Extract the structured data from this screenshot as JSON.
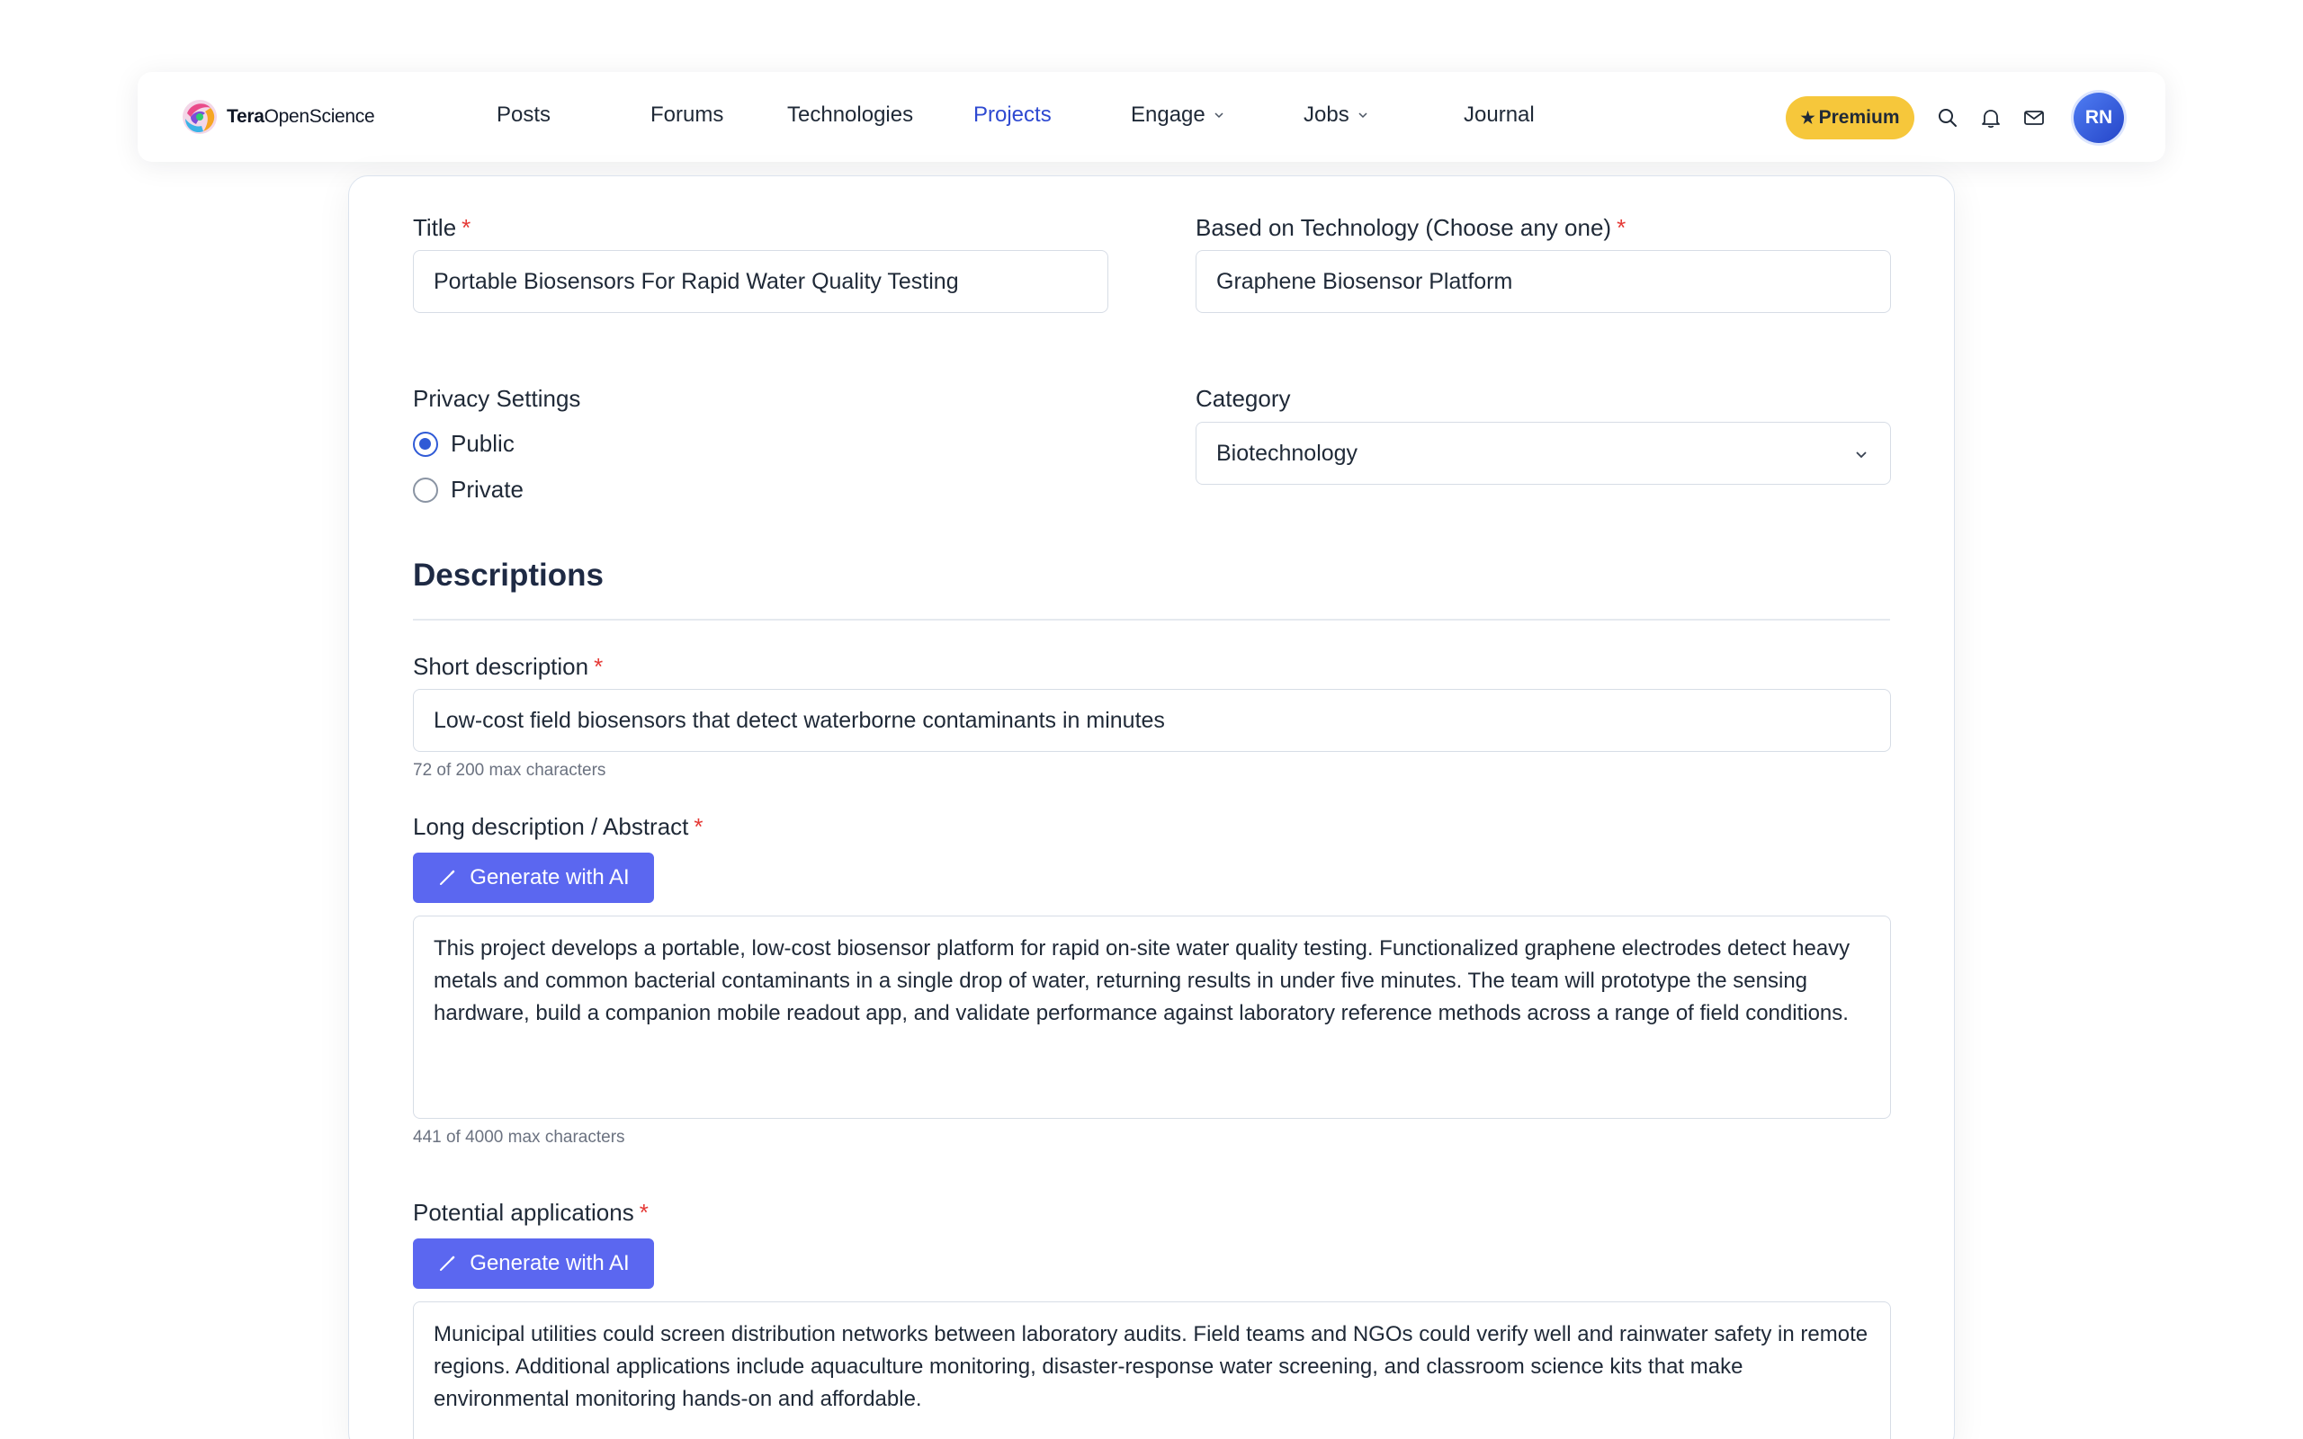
{
  "brand": {
    "name_bold": "Tera",
    "name_rest": "OpenScience"
  },
  "nav": {
    "items": [
      {
        "label": "Posts"
      },
      {
        "label": "Forums"
      },
      {
        "label": "Technologies"
      },
      {
        "label": "Projects",
        "active": true
      },
      {
        "label": "Engage",
        "dropdown": true
      },
      {
        "label": "Jobs",
        "dropdown": true
      },
      {
        "label": "Journal"
      }
    ],
    "premium_label": "Premium",
    "avatar_initials": "RN",
    "icons": [
      "search-icon",
      "bell-icon",
      "mail-icon"
    ]
  },
  "form": {
    "title": {
      "label": "Title",
      "required": "*",
      "value": "Portable Biosensors For Rapid Water Quality Testing"
    },
    "technology": {
      "label": "Based on Technology (Choose any one)",
      "required": "*",
      "value": "Graphene Biosensor Platform"
    },
    "privacy": {
      "label": "Privacy Settings",
      "options": [
        {
          "label": "Public",
          "checked": true
        },
        {
          "label": "Private",
          "checked": false
        }
      ]
    },
    "category": {
      "label": "Category",
      "value": "Biotechnology"
    },
    "descriptions_heading": "Descriptions",
    "short_description": {
      "label": "Short description",
      "required": "*",
      "value": "Low-cost field biosensors that detect waterborne contaminants in minutes",
      "counter": "72 of 200 max characters"
    },
    "long_description": {
      "label": "Long description / Abstract",
      "required": "*",
      "ai_button": "Generate with AI",
      "value": "This project develops a portable, low-cost biosensor platform for rapid on-site water quality testing. Functionalized graphene electrodes detect heavy metals and common bacterial contaminants in a single drop of water, returning results in under five minutes. The team will prototype the sensing hardware, build a companion mobile readout app, and validate performance against laboratory reference methods across a range of field conditions.",
      "counter": "441 of 4000 max characters"
    },
    "applications": {
      "label": "Potential applications",
      "required": "*",
      "ai_button": "Generate with AI",
      "value": "Municipal utilities could screen distribution networks between laboratory audits. Field teams and NGOs could verify well and rainwater safety in remote regions. Additional applications include aquaculture monitoring, disaster-response water screening, and classroom science kits that make environmental monitoring hands-on and affordable."
    }
  },
  "colors": {
    "accent": "#2e49d1",
    "ai_button": "#5b67f0",
    "premium": "#f6c73b",
    "required": "#e53935"
  }
}
